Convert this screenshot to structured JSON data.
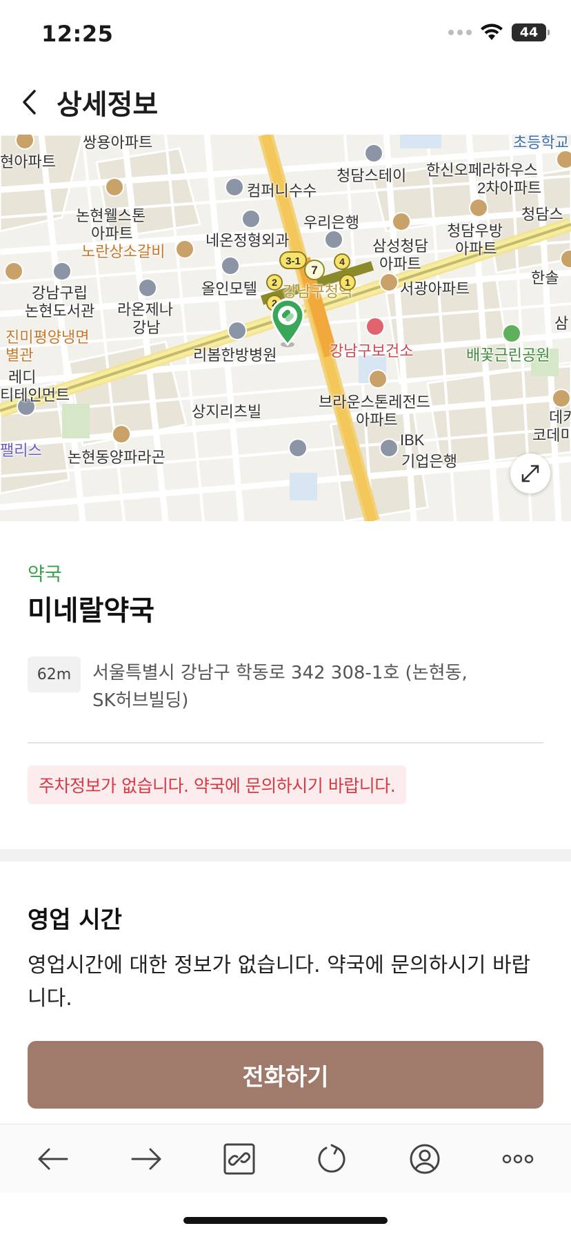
{
  "status_bar": {
    "time": "12:25",
    "battery": "44"
  },
  "header": {
    "title": "상세정보"
  },
  "map": {
    "labels": {
      "l1": "쌍용아파트",
      "l2": "현아파트",
      "l3": "청담스테이",
      "l4": "초등학교",
      "l5": "한신오페라하우스",
      "l6": "2차아파트",
      "l7": "청담스",
      "l8": "컴퍼니수수",
      "l9": "논현웰스톤",
      "l10": "아파트",
      "l11": "우리은행",
      "l12": "청담우방",
      "l13": "아파트",
      "l14": "네온정형외과",
      "l15": "삼성청담",
      "l16": "아파트",
      "l17": "노란상소갈비",
      "l18": "한솔",
      "l19": "강남구립",
      "l20": "논현도서관",
      "l21": "라온제나",
      "l22": "강남",
      "l23": "올인모텔",
      "l24": "강남구청역",
      "l25": "서광아파트",
      "l26": "진미평양냉면",
      "l27": "별관",
      "l28": "강남구보건소",
      "l29": "삼",
      "l30": "리봄한방병원",
      "l31": "배꽃근린공원",
      "l32": "레디",
      "l33": "티테인먼트",
      "l34": "상지리츠빌",
      "l35": "브라운스톤레전드",
      "l36": "아파트",
      "l37": "데카",
      "l38": "코데미어",
      "l39": "팰리스",
      "l40": "논현동양파라곤",
      "l41": "IBK",
      "l42": "기업은행"
    },
    "subway_badges": [
      "3-1",
      "7",
      "4",
      "1",
      "2",
      "2"
    ],
    "icons": {
      "expand": "expand-icon",
      "pin": "pharmacy-pin-icon"
    }
  },
  "place": {
    "category": "약국",
    "name": "미네랄약국",
    "distance": "62m",
    "address": "서울특별시 강남구 학동로 342 308-1호 (논현동, SK허브빌딩)",
    "parking_notice": "주차정보가 없습니다. 약국에 문의하시기 바랍니다."
  },
  "hours": {
    "title": "영업 시간",
    "text": "영업시간에 대한 정보가 없습니다. 약국에 문의하시기 바랍니다."
  },
  "call_button": {
    "label": "전화하기"
  },
  "toolbar": {
    "items": [
      "back-arrow-icon",
      "forward-arrow-icon",
      "link-icon",
      "refresh-icon",
      "profile-icon",
      "more-icon"
    ]
  },
  "colors": {
    "accent_brown": "#a07a6a",
    "category_green": "#3aa04a",
    "notice_red": "#d23a44",
    "notice_bg": "#fdecee"
  }
}
